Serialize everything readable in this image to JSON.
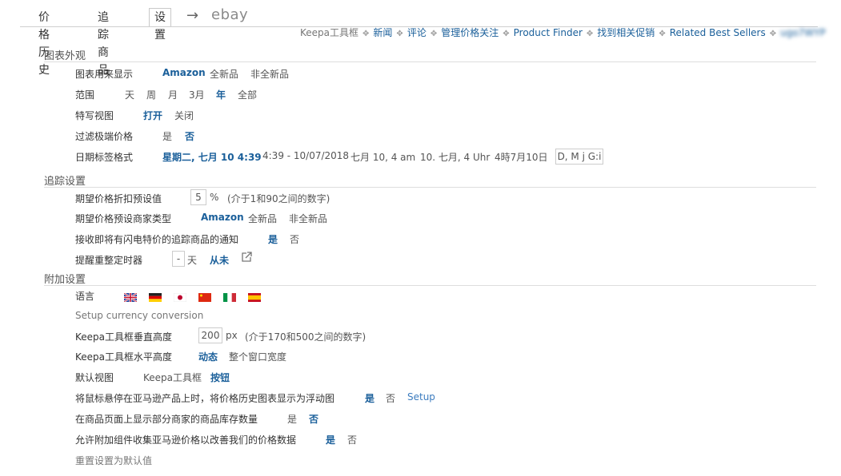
{
  "tabs": {
    "price_history": "价格历史",
    "tracked_products": "追踪商品",
    "settings": "设置",
    "arrow": "→",
    "ebay": "ebay"
  },
  "links": {
    "keepa_box": "Keepa工具框",
    "news": "新闻",
    "review": "评论",
    "manage_watch": "管理价格关注",
    "product_finder": "Product Finder",
    "find_deals": "找到相关促销",
    "related_sellers": "Related Best Sellers",
    "blurred_user": "ugo7WYP"
  },
  "chart_appearance": {
    "title": "图表外观",
    "display": {
      "label": "图表用来显示",
      "options": [
        "Amazon",
        "全新品",
        "非全新品"
      ],
      "selected": "Amazon"
    },
    "range": {
      "label": "范围",
      "options": [
        "天",
        "周",
        "月",
        "3月",
        "年",
        "全部"
      ],
      "selected": "年"
    },
    "close_up": {
      "label": "特写视图",
      "options": [
        "打开",
        "关闭"
      ],
      "selected": "打开"
    },
    "filter_extreme": {
      "label": "过滤极端价格",
      "options": [
        "是",
        "否"
      ],
      "selected": "否"
    },
    "date_format": {
      "label": "日期标签格式",
      "options": [
        "星期二, 七月 10 4:39",
        "4:39 - 10/07/2018",
        "七月 10, 4 am",
        "10. 七月, 4 Uhr",
        "4時7月10日"
      ],
      "selected": "星期二, 七月 10 4:39",
      "custom_value": "D, M j G:i"
    }
  },
  "tracking": {
    "title": "追踪设置",
    "discount": {
      "label": "期望价格折扣预设值",
      "value": "5",
      "unit": "%",
      "hint": "(介于1和90之间的数字)"
    },
    "seller_type": {
      "label": "期望价格预设商家类型",
      "options": [
        "Amazon",
        "全新品",
        "非全新品"
      ],
      "selected": "Amazon"
    },
    "lightning": {
      "label": "接收即将有闪电特价的追踪商品的通知",
      "options": [
        "是",
        "否"
      ],
      "selected": "是"
    },
    "reminder": {
      "label": "提醒重整定时器",
      "value": "-",
      "unit": "天",
      "never": "从未"
    }
  },
  "additional": {
    "title": "附加设置",
    "language": {
      "label": "语言",
      "flags": [
        "uk",
        "de",
        "jp",
        "cn",
        "it",
        "es"
      ]
    },
    "currency_link": "Setup currency conversion",
    "box_height": {
      "label": "Keepa工具框垂直高度",
      "value": "200",
      "unit": "px",
      "hint": "(介于170和500之间的数字)"
    },
    "box_width": {
      "label": "Keepa工具框水平高度",
      "options": [
        "动态",
        "整个窗口宽度"
      ],
      "selected": "动态"
    },
    "default_view": {
      "label": "默认视图",
      "options": [
        "Keepa工具框",
        "按钮"
      ],
      "selected": "按钮"
    },
    "hover_chart": {
      "label": "将鼠标悬停在亚马逊产品上时，将价格历史图表显示为浮动图",
      "options": [
        "是",
        "否"
      ],
      "selected": "是",
      "setup": "Setup"
    },
    "stock_display": {
      "label": "在商品页面上显示部分商家的商品库存数量",
      "options": [
        "是",
        "否"
      ],
      "selected": "否"
    },
    "collect_prices": {
      "label": "允许附加组件收集亚马逊价格以改善我们的价格数据",
      "options": [
        "是",
        "否"
      ],
      "selected": "是"
    },
    "reset": "重置设置为默认值"
  },
  "colors": {
    "accent": "#1a5f9a",
    "link": "#3c7cbf",
    "rule": "#dddddd"
  }
}
